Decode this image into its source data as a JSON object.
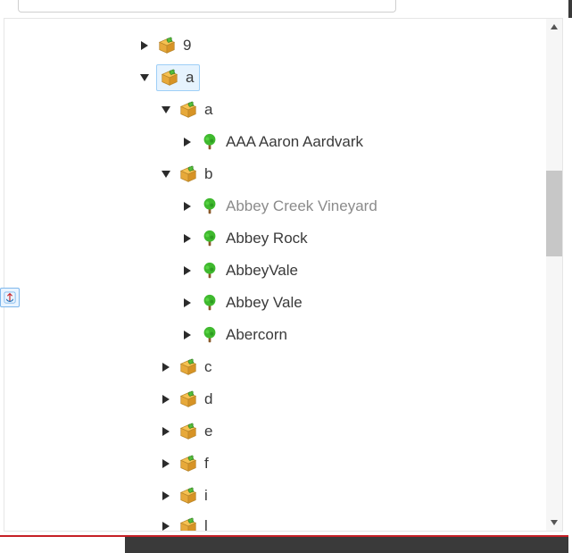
{
  "top_input": {
    "value": ""
  },
  "tree": {
    "nodes": [
      {
        "level": 0,
        "expanded": false,
        "type": "box",
        "label": "9",
        "selected": false
      },
      {
        "level": 0,
        "expanded": true,
        "type": "box",
        "label": "a",
        "selected": true
      },
      {
        "level": 1,
        "expanded": true,
        "type": "box",
        "label": "a",
        "selected": false
      },
      {
        "level": 2,
        "expanded": false,
        "type": "tree",
        "label": "AAA Aaron Aardvark",
        "selected": false
      },
      {
        "level": 1,
        "expanded": true,
        "type": "box",
        "label": "b",
        "selected": false
      },
      {
        "level": 2,
        "expanded": false,
        "type": "tree",
        "label": "Abbey Creek Vineyard",
        "muted": true,
        "selected": false
      },
      {
        "level": 2,
        "expanded": false,
        "type": "tree",
        "label": "Abbey Rock",
        "selected": false
      },
      {
        "level": 2,
        "expanded": false,
        "type": "tree",
        "label": "AbbeyVale",
        "selected": false
      },
      {
        "level": 2,
        "expanded": false,
        "type": "tree",
        "label": "Abbey Vale",
        "selected": false
      },
      {
        "level": 2,
        "expanded": false,
        "type": "tree",
        "label": "Abercorn",
        "selected": false
      },
      {
        "level": 1,
        "expanded": false,
        "type": "box",
        "label": "c",
        "selected": false
      },
      {
        "level": 1,
        "expanded": false,
        "type": "box",
        "label": "d",
        "selected": false
      },
      {
        "level": 1,
        "expanded": false,
        "type": "box",
        "label": "e",
        "selected": false
      },
      {
        "level": 1,
        "expanded": false,
        "type": "box",
        "label": "f",
        "selected": false
      },
      {
        "level": 1,
        "expanded": false,
        "type": "box",
        "label": "i",
        "selected": false
      },
      {
        "level": 1,
        "expanded": false,
        "type": "box",
        "label": "l",
        "selected": false
      }
    ]
  }
}
